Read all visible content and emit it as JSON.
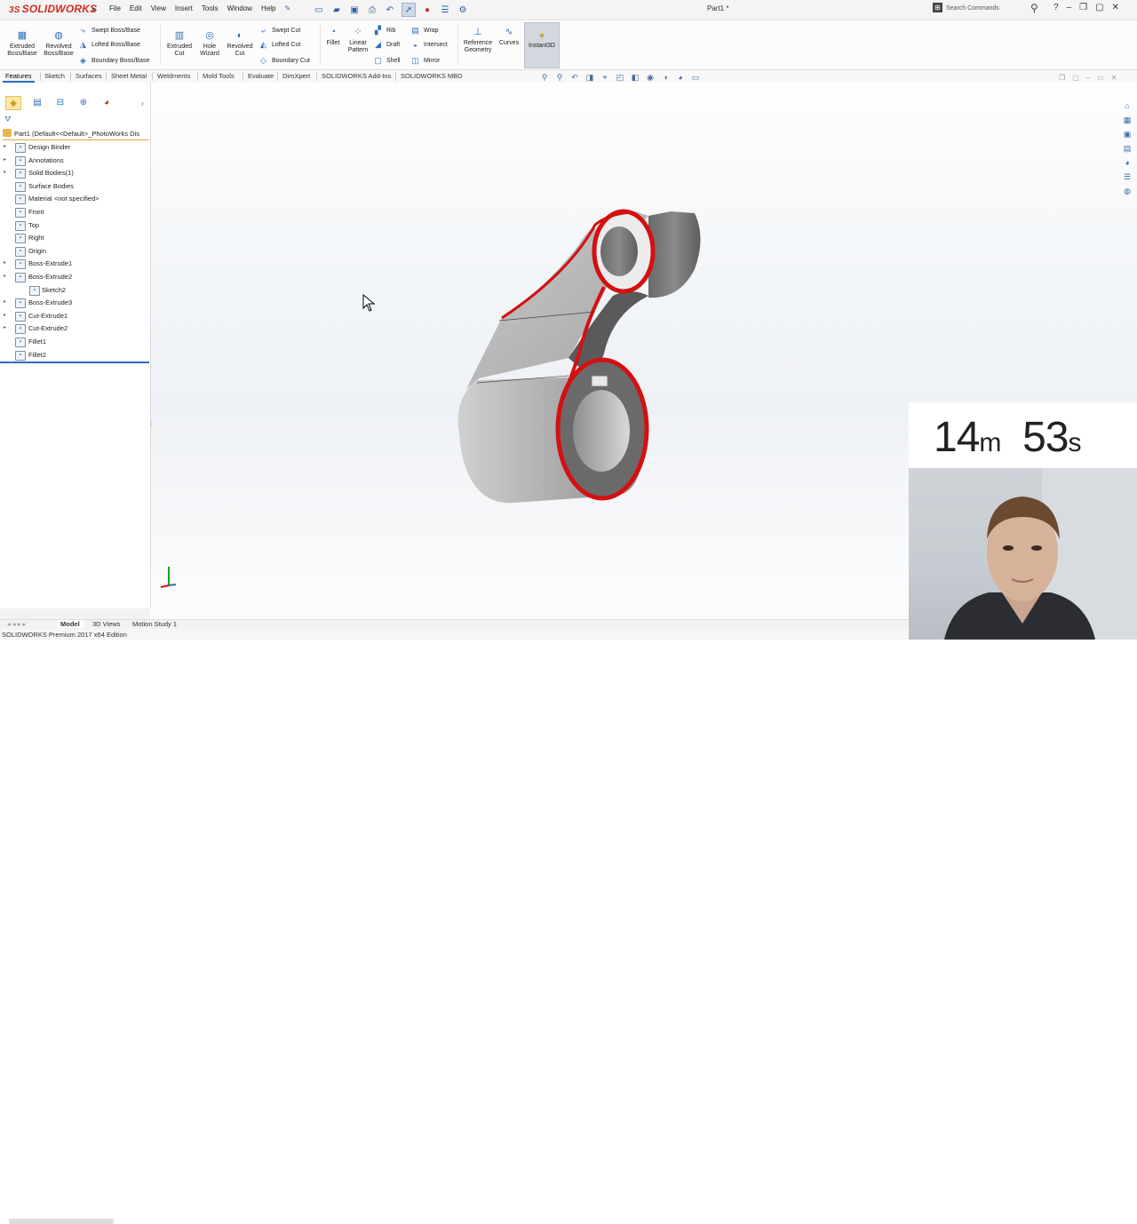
{
  "app": {
    "logo_text": "SOLIDWORKS",
    "document_title": "Part1 *",
    "menu": [
      "File",
      "Edit",
      "View",
      "Insert",
      "Tools",
      "Window",
      "Help"
    ],
    "search_placeholder": "Search Commands"
  },
  "ribbon": {
    "extruded_boss": "Extruded Boss/Base",
    "revolved_boss": "Revolved Boss/Base",
    "swept_boss": "Swept Boss/Base",
    "lofted_boss": "Lofted Boss/Base",
    "boundary_boss": "Boundary Boss/Base",
    "extruded_cut": "Extruded Cut",
    "hole_wizard": "Hole Wizard",
    "revolved_cut": "Revolved Cut",
    "swept_cut": "Swept Cut",
    "lofted_cut": "Lofted Cut",
    "boundary_cut": "Boundary Cut",
    "fillet": "Fillet",
    "linear_pattern": "Linear Pattern",
    "rib": "Rib",
    "draft": "Draft",
    "shell": "Shell",
    "wrap": "Wrap",
    "intersect": "Intersect",
    "mirror": "Mirror",
    "reference_geometry": "Reference Geometry",
    "curves": "Curves",
    "instant3d": "Instant3D"
  },
  "tabs": [
    "Features",
    "Sketch",
    "Surfaces",
    "Sheet Metal",
    "Weldments",
    "Mold Tools",
    "Evaluate",
    "DimXpert",
    "SOLIDWORKS Add-Ins",
    "SOLIDWORKS MBD"
  ],
  "feature_tree": {
    "root": "Part1  (Default<<Default>_PhotoWorks Dis",
    "nodes": [
      {
        "label": "Design Binder",
        "expand": true,
        "child": false
      },
      {
        "label": "Annotations",
        "expand": true,
        "child": false
      },
      {
        "label": "Solid Bodies(1)",
        "expand": true,
        "child": false
      },
      {
        "label": "Surface Bodies",
        "expand": false,
        "child": false
      },
      {
        "label": "Material <not specified>",
        "expand": false,
        "child": false
      },
      {
        "label": "Front",
        "expand": false,
        "child": false
      },
      {
        "label": "Top",
        "expand": false,
        "child": false
      },
      {
        "label": "Right",
        "expand": false,
        "child": false
      },
      {
        "label": "Origin",
        "expand": false,
        "child": false
      },
      {
        "label": "Boss-Extrude1",
        "expand": true,
        "child": false
      },
      {
        "label": "Boss-Extrude2",
        "expand": true,
        "child": false
      },
      {
        "label": "Sketch2",
        "expand": false,
        "child": true
      },
      {
        "label": "Boss-Extrude3",
        "expand": true,
        "child": false
      },
      {
        "label": "Cut-Extrude1",
        "expand": true,
        "child": false
      },
      {
        "label": "Cut-Extrude2",
        "expand": true,
        "child": false
      },
      {
        "label": "Fillet1",
        "expand": false,
        "child": false
      },
      {
        "label": "Fillet2",
        "expand": false,
        "child": false
      }
    ]
  },
  "bottom_tabs": [
    "Model",
    "3D Views",
    "Motion Study 1"
  ],
  "status_text": "SOLIDWORKS Premium 2017 x64 Edition",
  "timer": {
    "minutes": "14",
    "m_unit": "m",
    "seconds": "53",
    "s_unit": "s"
  },
  "colors": {
    "accent": "#2f6db5",
    "brand_red": "#d52b1e",
    "edge_highlight": "#d41010"
  }
}
